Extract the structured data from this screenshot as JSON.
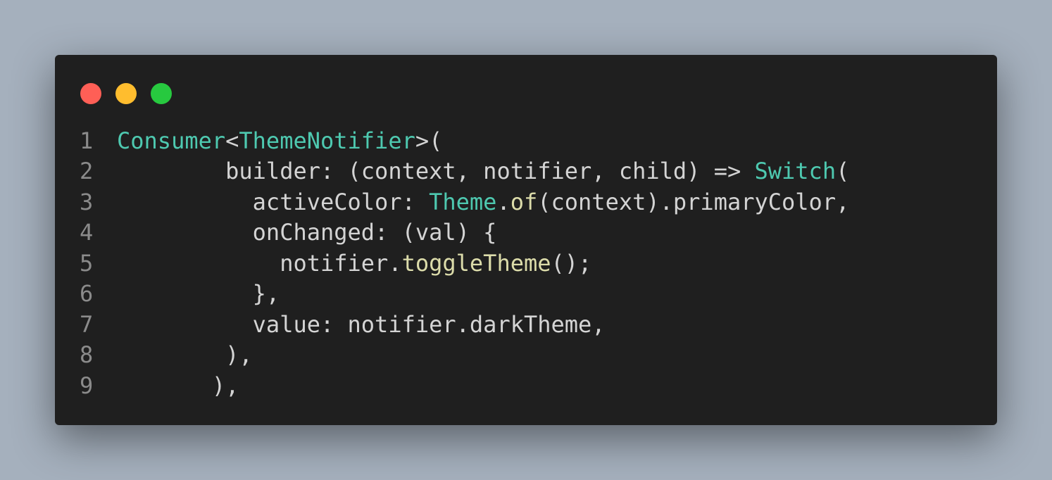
{
  "window": {
    "controls": [
      {
        "name": "close",
        "color": "#ff5f56"
      },
      {
        "name": "minimize",
        "color": "#ffbd2e"
      },
      {
        "name": "zoom",
        "color": "#27c93f"
      }
    ]
  },
  "colors": {
    "background": "#a5b0bd",
    "editor": "#1f1f1f",
    "plain": "#d4d4d4",
    "type": "#4ec9b0",
    "function": "#dcdcaa",
    "line_number": "#8b8b8b"
  },
  "code": {
    "lines": [
      {
        "number": "1",
        "tokens": [
          {
            "t": "type",
            "v": "Consumer"
          },
          {
            "t": "plain",
            "v": "<"
          },
          {
            "t": "type",
            "v": "ThemeNotifier"
          },
          {
            "t": "plain",
            "v": ">("
          }
        ]
      },
      {
        "number": "2",
        "tokens": [
          {
            "t": "plain",
            "v": "        builder: (context, notifier, child) => "
          },
          {
            "t": "type",
            "v": "Switch"
          },
          {
            "t": "plain",
            "v": "("
          }
        ]
      },
      {
        "number": "3",
        "tokens": [
          {
            "t": "plain",
            "v": "          activeColor: "
          },
          {
            "t": "type",
            "v": "Theme"
          },
          {
            "t": "plain",
            "v": "."
          },
          {
            "t": "fn",
            "v": "of"
          },
          {
            "t": "plain",
            "v": "(context).primaryColor,"
          }
        ]
      },
      {
        "number": "4",
        "tokens": [
          {
            "t": "plain",
            "v": "          onChanged: (val) {"
          }
        ]
      },
      {
        "number": "5",
        "tokens": [
          {
            "t": "plain",
            "v": "            notifier."
          },
          {
            "t": "fn",
            "v": "toggleTheme"
          },
          {
            "t": "plain",
            "v": "();"
          }
        ]
      },
      {
        "number": "6",
        "tokens": [
          {
            "t": "plain",
            "v": "          },"
          }
        ]
      },
      {
        "number": "7",
        "tokens": [
          {
            "t": "plain",
            "v": "          value: notifier.darkTheme,"
          }
        ]
      },
      {
        "number": "8",
        "tokens": [
          {
            "t": "plain",
            "v": "        ),"
          }
        ]
      },
      {
        "number": "9",
        "tokens": [
          {
            "t": "plain",
            "v": "       ),"
          }
        ]
      }
    ]
  }
}
